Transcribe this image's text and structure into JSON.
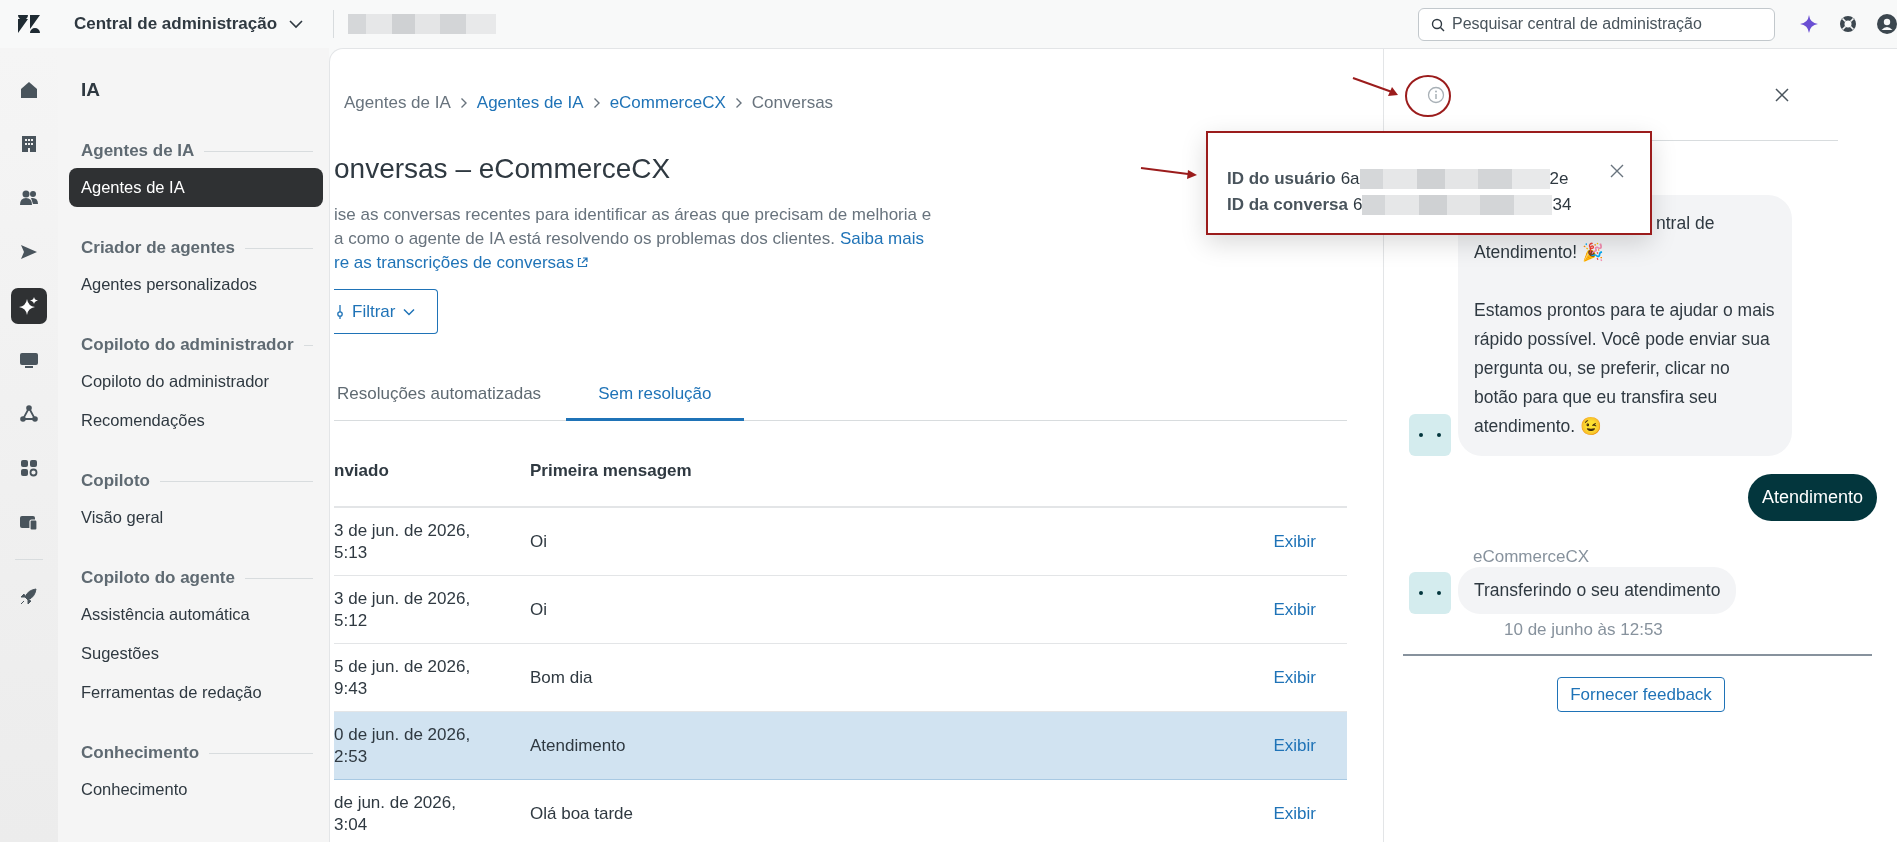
{
  "top_bar": {
    "app_title": "Central de administração",
    "search": {
      "placeholder": "Pesquisar central de administração"
    }
  },
  "rail": [
    {
      "kind": "home",
      "selected": false
    },
    {
      "kind": "building",
      "selected": false
    },
    {
      "kind": "people",
      "selected": false
    },
    {
      "kind": "send",
      "selected": false
    },
    {
      "kind": "sparkle",
      "selected": true
    },
    {
      "kind": "monitor",
      "selected": false
    },
    {
      "kind": "nodes",
      "selected": false
    },
    {
      "kind": "apps",
      "selected": false
    },
    {
      "kind": "devices",
      "selected": false
    },
    {
      "kind": "divider"
    },
    {
      "kind": "rocket",
      "selected": false
    }
  ],
  "nav": {
    "title": "IA",
    "sections": [
      {
        "heading": "Agentes de IA",
        "items": [
          {
            "label": "Agentes de IA",
            "selected": true
          }
        ]
      },
      {
        "heading": "Criador de agentes",
        "items": [
          {
            "label": "Agentes personalizados",
            "selected": false
          }
        ]
      },
      {
        "heading": "Copiloto do administrador",
        "items": [
          {
            "label": "Copiloto do administrador",
            "selected": false
          },
          {
            "label": "Recomendações",
            "selected": false
          }
        ]
      },
      {
        "heading": "Copiloto",
        "items": [
          {
            "label": "Visão geral",
            "selected": false
          }
        ]
      },
      {
        "heading": "Copiloto do agente",
        "items": [
          {
            "label": "Assistência automática",
            "selected": false
          },
          {
            "label": "Sugestões",
            "selected": false
          },
          {
            "label": "Ferramentas de redação",
            "selected": false
          }
        ]
      },
      {
        "heading": "Conhecimento",
        "items": [
          {
            "label": "Conhecimento",
            "selected": false
          }
        ]
      }
    ]
  },
  "breadcrumb": [
    {
      "label": "Agentes de IA",
      "link": false
    },
    {
      "label": "Agentes de IA",
      "link": true
    },
    {
      "label": "eCommerceCX",
      "link": true
    },
    {
      "label": "Conversas",
      "link": false
    }
  ],
  "page_title": "onversas – eCommerceCX",
  "description": [
    {
      "text": "ise as conversas recentes para identificar as áreas que precisam de melhoria e"
    },
    {
      "text": "a como o agente de IA está resolvendo os problemas dos clientes.",
      "link": "Saiba mais"
    },
    {
      "link": "re as transcrições de conversas",
      "external": true
    }
  ],
  "filter_button": "Filtrar",
  "tabs": [
    {
      "label": "Resoluções automatizadas",
      "selected": false
    },
    {
      "label": "Sem resolução",
      "selected": true
    }
  ],
  "table": {
    "columns": [
      "nviado",
      "Primeira mensagem"
    ],
    "rows": [
      {
        "sent": [
          "3 de jun. de 2026,",
          "5:13"
        ],
        "first_message": "Oi",
        "action": "Exibir",
        "selected": false
      },
      {
        "sent": [
          "3 de jun. de 2026,",
          "5:12"
        ],
        "first_message": "Oi",
        "action": "Exibir",
        "selected": false
      },
      {
        "sent": [
          "5 de jun. de 2026,",
          "9:43"
        ],
        "first_message": "Bom dia",
        "action": "Exibir",
        "selected": false
      },
      {
        "sent": [
          "0 de jun. de 2026,",
          "2:53"
        ],
        "first_message": "Atendimento",
        "action": "Exibir",
        "selected": true
      },
      {
        "sent": [
          "de jun. de 2026,",
          "3:04"
        ],
        "first_message": "Olá boa tarde",
        "action": "Exibir",
        "selected": false
      }
    ]
  },
  "chat_panel": {
    "messages": [
      {
        "kind": "bot",
        "paragraphs": [
          "ntral de",
          "Atendimento! 🎉",
          "Estamos prontos para te ajudar o mais rápido possível. Você pode enviar sua pergunta ou, se preferir, clicar no botão para que eu transfira seu atendimento. 😉"
        ]
      },
      {
        "kind": "user",
        "text": "Atendimento"
      },
      {
        "kind": "bot",
        "sender": "eCommerceCX",
        "paragraphs": [
          "Transferindo o seu atendimento"
        ],
        "time": "10 de junho às 12:53"
      }
    ],
    "feedback_button": "Fornecer feedback"
  },
  "info_popup": {
    "rows": [
      {
        "label": "ID do usuário",
        "start": "6a",
        "end": "2e"
      },
      {
        "label": "ID da conversa",
        "start": "6",
        "end": "34"
      }
    ]
  }
}
